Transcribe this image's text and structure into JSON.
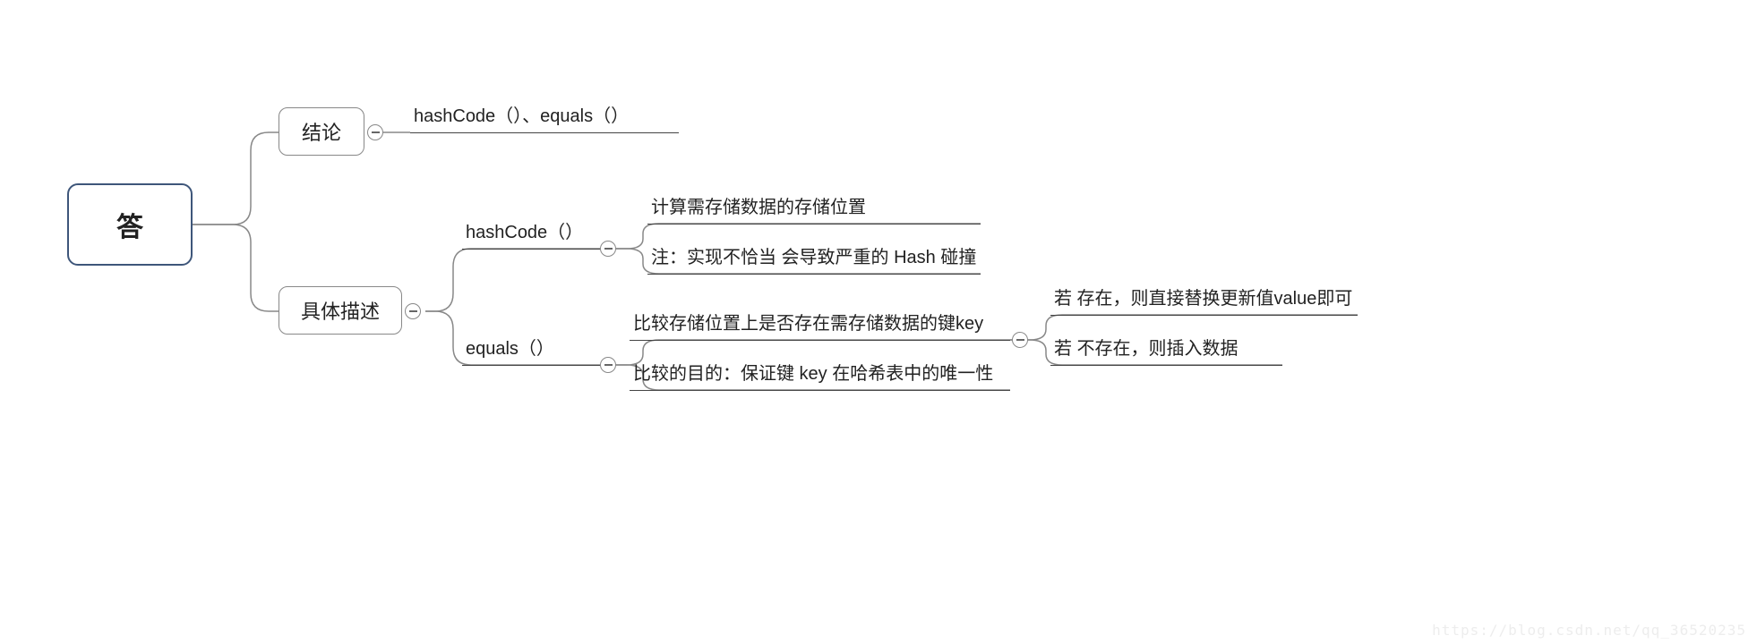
{
  "root": "答",
  "c1": {
    "label": "结论",
    "leaf": "hashCode（）、equals（）"
  },
  "c2": {
    "label": "具体描述",
    "g1": {
      "label": "hashCode（）",
      "leaf1": "计算需存储数据的存储位置",
      "leaf2": "注：实现不恰当 会导致严重的 Hash 碰撞"
    },
    "g2": {
      "label": "equals（）",
      "leaf1": {
        "text": "比较存储位置上是否存在需存储数据的键key",
        "sub1": "若 存在，则直接替换更新值value即可",
        "sub2": "若 不存在，则插入数据"
      },
      "leaf2": "比较的目的：保证键 key 在哈希表中的唯一性"
    }
  },
  "watermark": "https://blog.csdn.net/qq_36520235"
}
